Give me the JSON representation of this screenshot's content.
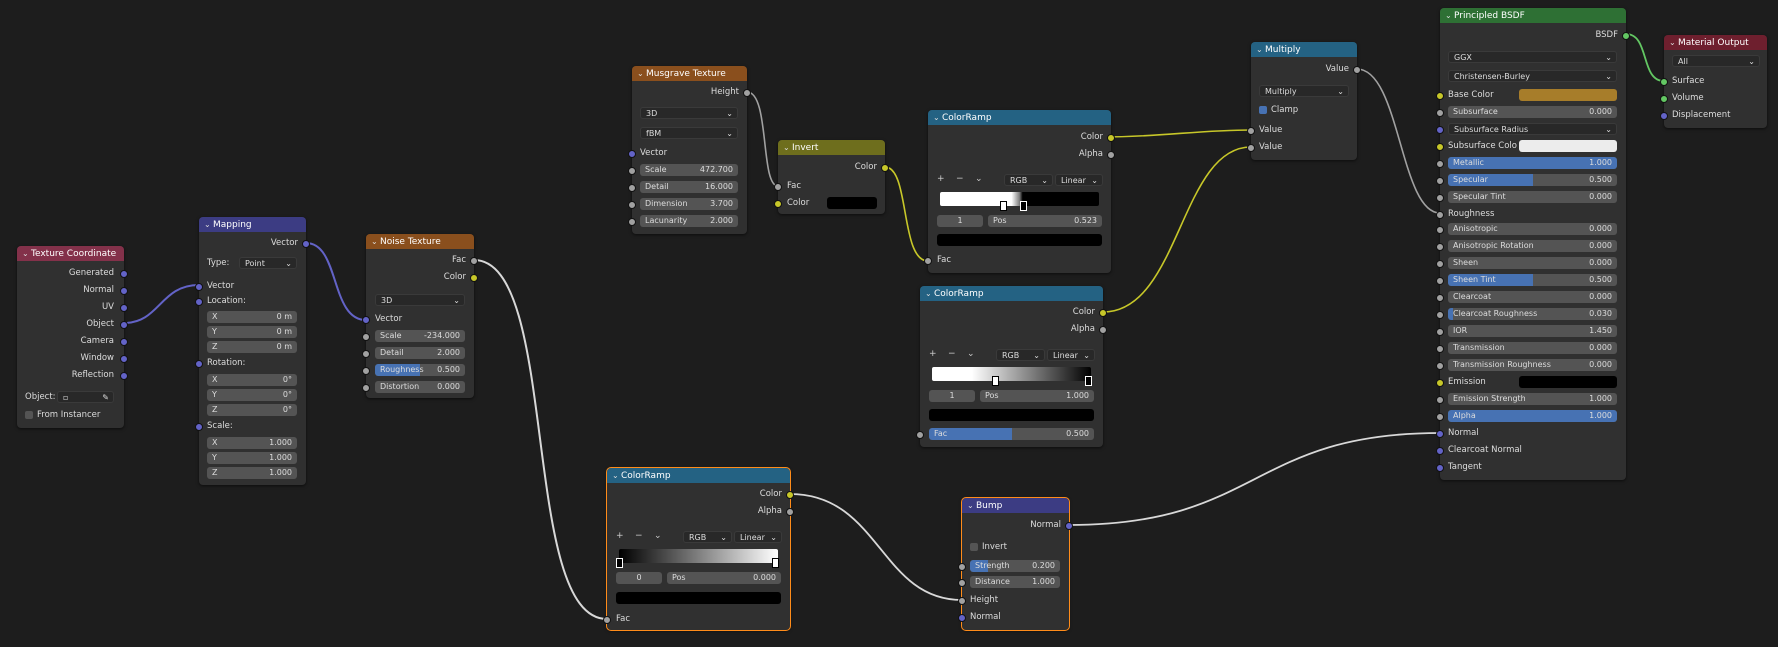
{
  "colors": {
    "vector": "#6363c7",
    "gray": "#a1a1a1",
    "yellow": "#c7c729",
    "green": "#63c763",
    "wire": "#d8d8d8"
  },
  "texcoord": {
    "title": "Texture Coordinate",
    "outputs": [
      "Generated",
      "Normal",
      "UV",
      "Object",
      "Camera",
      "Window",
      "Reflection"
    ],
    "object_label": "Object:",
    "from_instancer": "From Instancer"
  },
  "mapping": {
    "title": "Mapping",
    "out": "Vector",
    "type_label": "Type:",
    "type_value": "Point",
    "vector": "Vector",
    "location": "Location:",
    "rotation": "Rotation:",
    "scale": "Scale:",
    "loc": [
      {
        "k": "X",
        "v": "0 m"
      },
      {
        "k": "Y",
        "v": "0 m"
      },
      {
        "k": "Z",
        "v": "0 m"
      }
    ],
    "rot": [
      {
        "k": "X",
        "v": "0°"
      },
      {
        "k": "Y",
        "v": "0°"
      },
      {
        "k": "Z",
        "v": "0°"
      }
    ],
    "scl": [
      {
        "k": "X",
        "v": "1.000"
      },
      {
        "k": "Y",
        "v": "1.000"
      },
      {
        "k": "Z",
        "v": "1.000"
      }
    ]
  },
  "noise": {
    "title": "Noise Texture",
    "fac": "Fac",
    "color": "Color",
    "dim": "3D",
    "vector": "Vector",
    "fields": [
      {
        "k": "Scale",
        "v": "-234.000"
      },
      {
        "k": "Detail",
        "v": "2.000"
      },
      {
        "k": "Roughness",
        "v": "0.500"
      },
      {
        "k": "Distortion",
        "v": "0.000"
      }
    ]
  },
  "musgrave": {
    "title": "Musgrave Texture",
    "height": "Height",
    "dim": "3D",
    "type": "fBM",
    "vector": "Vector",
    "fields": [
      {
        "k": "Scale",
        "v": "472.700"
      },
      {
        "k": "Detail",
        "v": "16.000"
      },
      {
        "k": "Dimension",
        "v": "3.700"
      },
      {
        "k": "Lacunarity",
        "v": "2.000"
      }
    ]
  },
  "invert": {
    "title": "Invert",
    "color_out": "Color",
    "fac": "Fac",
    "color": "Color"
  },
  "ramp1": {
    "title": "ColorRamp",
    "color": "Color",
    "alpha": "Alpha",
    "mode": "RGB",
    "interp": "Linear",
    "index": "1",
    "pos_label": "Pos",
    "pos": "0.523",
    "fac": "Fac"
  },
  "ramp2": {
    "title": "ColorRamp",
    "color": "Color",
    "alpha": "Alpha",
    "mode": "RGB",
    "interp": "Linear",
    "index": "1",
    "pos_label": "Pos",
    "pos": "1.000",
    "fac": "Fac",
    "fac_value": "0.500",
    "fac_fraction": 0.5
  },
  "ramp3": {
    "title": "ColorRamp",
    "color": "Color",
    "alpha": "Alpha",
    "mode": "RGB",
    "interp": "Linear",
    "index": "0",
    "pos_label": "Pos",
    "pos": "0.000",
    "fac": "Fac"
  },
  "multiply": {
    "title": "Multiply",
    "value_out": "Value",
    "op": "Multiply",
    "clamp": "Clamp",
    "in1": "Value",
    "in2": "Value"
  },
  "bump": {
    "title": "Bump",
    "normal_out": "Normal",
    "invert": "Invert",
    "strength": "Strength",
    "strength_v": "0.200",
    "strength_fraction": 0.2,
    "distance": "Distance",
    "distance_v": "1.000",
    "height": "Height",
    "normal": "Normal"
  },
  "bsdf": {
    "title": "Principled BSDF",
    "out": "BSDF",
    "dist": "GGX",
    "sss": "Christensen-Burley",
    "base_color": "Base Color",
    "base_color_hex": "#a77d2a",
    "subsurface_color": "Subsurface Colo",
    "emission": "Emission",
    "roughness": "Roughness",
    "normal": "Normal",
    "clearcoat_normal": "Clearcoat Normal",
    "tangent": "Tangent",
    "rows": [
      {
        "k": "Subsurface",
        "v": "0.000",
        "f": 0
      },
      {
        "k": "Subsurface Radius",
        "v": "",
        "f": 0
      },
      {
        "k": "Metallic",
        "v": "1.000",
        "f": 1
      },
      {
        "k": "Specular",
        "v": "0.500",
        "f": 0.5
      },
      {
        "k": "Specular Tint",
        "v": "0.000",
        "f": 0
      },
      {
        "k": "Anisotropic",
        "v": "0.000",
        "f": 0
      },
      {
        "k": "Anisotropic Rotation",
        "v": "0.000",
        "f": 0
      },
      {
        "k": "Sheen",
        "v": "0.000",
        "f": 0
      },
      {
        "k": "Sheen Tint",
        "v": "0.500",
        "f": 0.5
      },
      {
        "k": "Clearcoat",
        "v": "0.000",
        "f": 0
      },
      {
        "k": "Clearcoat Roughness",
        "v": "0.030",
        "f": 0.03
      },
      {
        "k": "IOR",
        "v": "1.450",
        "f": 0
      },
      {
        "k": "Transmission",
        "v": "0.000",
        "f": 0
      },
      {
        "k": "Transmission Roughness",
        "v": "0.000",
        "f": 0
      },
      {
        "k": "Emission Strength",
        "v": "1.000",
        "f": 0
      },
      {
        "k": "Alpha",
        "v": "1.000",
        "f": 1
      }
    ]
  },
  "output": {
    "title": "Material Output",
    "target": "All",
    "surface": "Surface",
    "volume": "Volume",
    "displacement": "Displacement"
  }
}
